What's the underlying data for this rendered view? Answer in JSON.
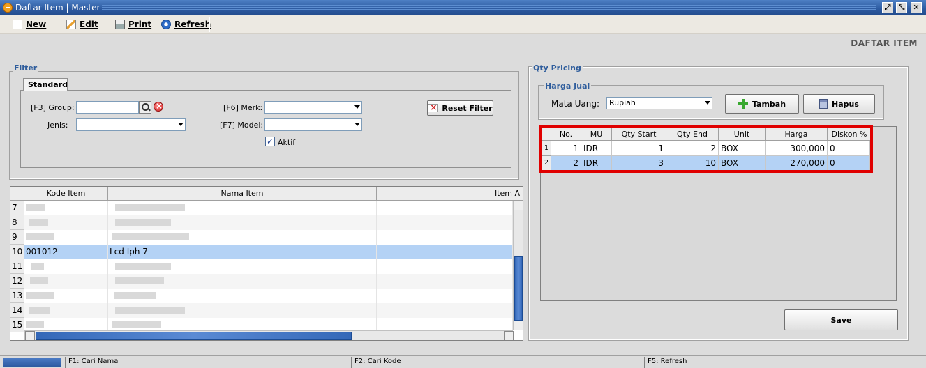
{
  "window": {
    "title": "Daftar Item | Master",
    "icon": "app-icon"
  },
  "toolbar": {
    "new_label": "New",
    "edit_label": "Edit",
    "print_label": "Print",
    "refresh_label": "Refresh"
  },
  "page_header": "DAFTAR ITEM",
  "filter": {
    "legend": "Filter",
    "tab_label": "Standard",
    "group_label": "[F3] Group:",
    "group_value": "",
    "jenis_label": "Jenis:",
    "jenis_value": "",
    "merk_label": "[F6] Merk:",
    "merk_value": "",
    "model_label": "[F7] Model:",
    "model_value": "",
    "aktif_label": "Aktif",
    "aktif_checked": true,
    "reset_label": "Reset Filter"
  },
  "item_grid": {
    "columns": [
      "Kode Item",
      "Nama Item",
      "Item A"
    ],
    "rows": [
      {
        "num": "7",
        "kode": "",
        "nama": ""
      },
      {
        "num": "8",
        "kode": "",
        "nama": ""
      },
      {
        "num": "9",
        "kode": "",
        "nama": ""
      },
      {
        "num": "10",
        "kode": "001012",
        "nama": "Lcd Iph 7",
        "selected": true
      },
      {
        "num": "11",
        "kode": "",
        "nama": ""
      },
      {
        "num": "12",
        "kode": "",
        "nama": ""
      },
      {
        "num": "13",
        "kode": "",
        "nama": ""
      },
      {
        "num": "14",
        "kode": "",
        "nama": ""
      },
      {
        "num": "15",
        "kode": "",
        "nama": ""
      }
    ]
  },
  "qty_pricing": {
    "legend": "Qty Pricing",
    "harga_jual_legend": "Harga Jual",
    "mata_uang_label": "Mata Uang:",
    "mata_uang_value": "Rupiah",
    "tambah_label": "Tambah",
    "hapus_label": "Hapus",
    "columns": [
      "No.",
      "MU",
      "Qty Start",
      "Qty End",
      "Unit",
      "Harga",
      "Diskon %"
    ],
    "rows": [
      {
        "rownum": "1",
        "no": "1",
        "mu": "IDR",
        "qty_start": "1",
        "qty_end": "2",
        "unit": "BOX",
        "harga": "300,000",
        "diskon": "0"
      },
      {
        "rownum": "2",
        "no": "2",
        "mu": "IDR",
        "qty_start": "3",
        "qty_end": "10",
        "unit": "BOX",
        "harga": "270,000",
        "diskon": "0",
        "selected": true
      }
    ],
    "save_label": "Save"
  },
  "statusbar": {
    "f1": "F1: Cari Nama",
    "f2": "F2: Cari Kode",
    "f5": "F5: Refresh"
  },
  "colors": {
    "selection": "#b4d2f5",
    "highlight_border": "#e00000",
    "titlebar": "#2c5aa0",
    "legend_text": "#2f5d9c"
  }
}
